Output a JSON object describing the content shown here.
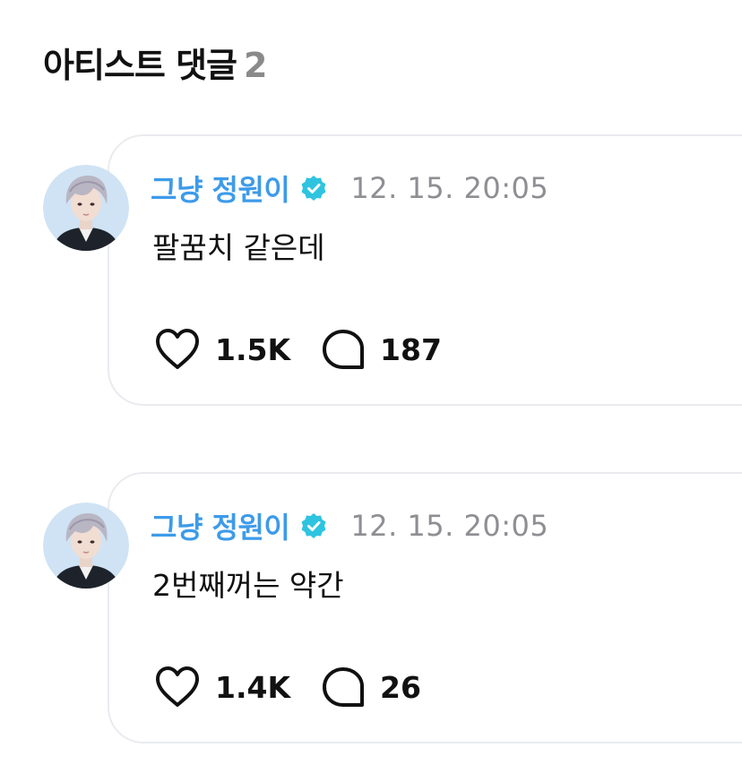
{
  "header": {
    "title": "아티스트 댓글",
    "count": "2"
  },
  "comments": [
    {
      "author": "그냥 정원이",
      "verified": true,
      "time": "12. 15. 20:05",
      "text": "팔꿈치 같은데",
      "likes": "1.5K",
      "replies": "187"
    },
    {
      "author": "그냥 정원이",
      "verified": true,
      "time": "12. 15. 20:05",
      "text": "2번째꺼는 약간",
      "likes": "1.4K",
      "replies": "26"
    }
  ],
  "colors": {
    "author": "#3d9be9",
    "verified_badge": "#2ec4e0",
    "timestamp": "#8e8e93",
    "count": "#8a8a8a",
    "card_border": "#e9ebef"
  },
  "icons": {
    "avatar": "profile-photo",
    "badge": "verified-check-icon",
    "like": "heart-icon",
    "reply": "speech-bubble-icon"
  }
}
